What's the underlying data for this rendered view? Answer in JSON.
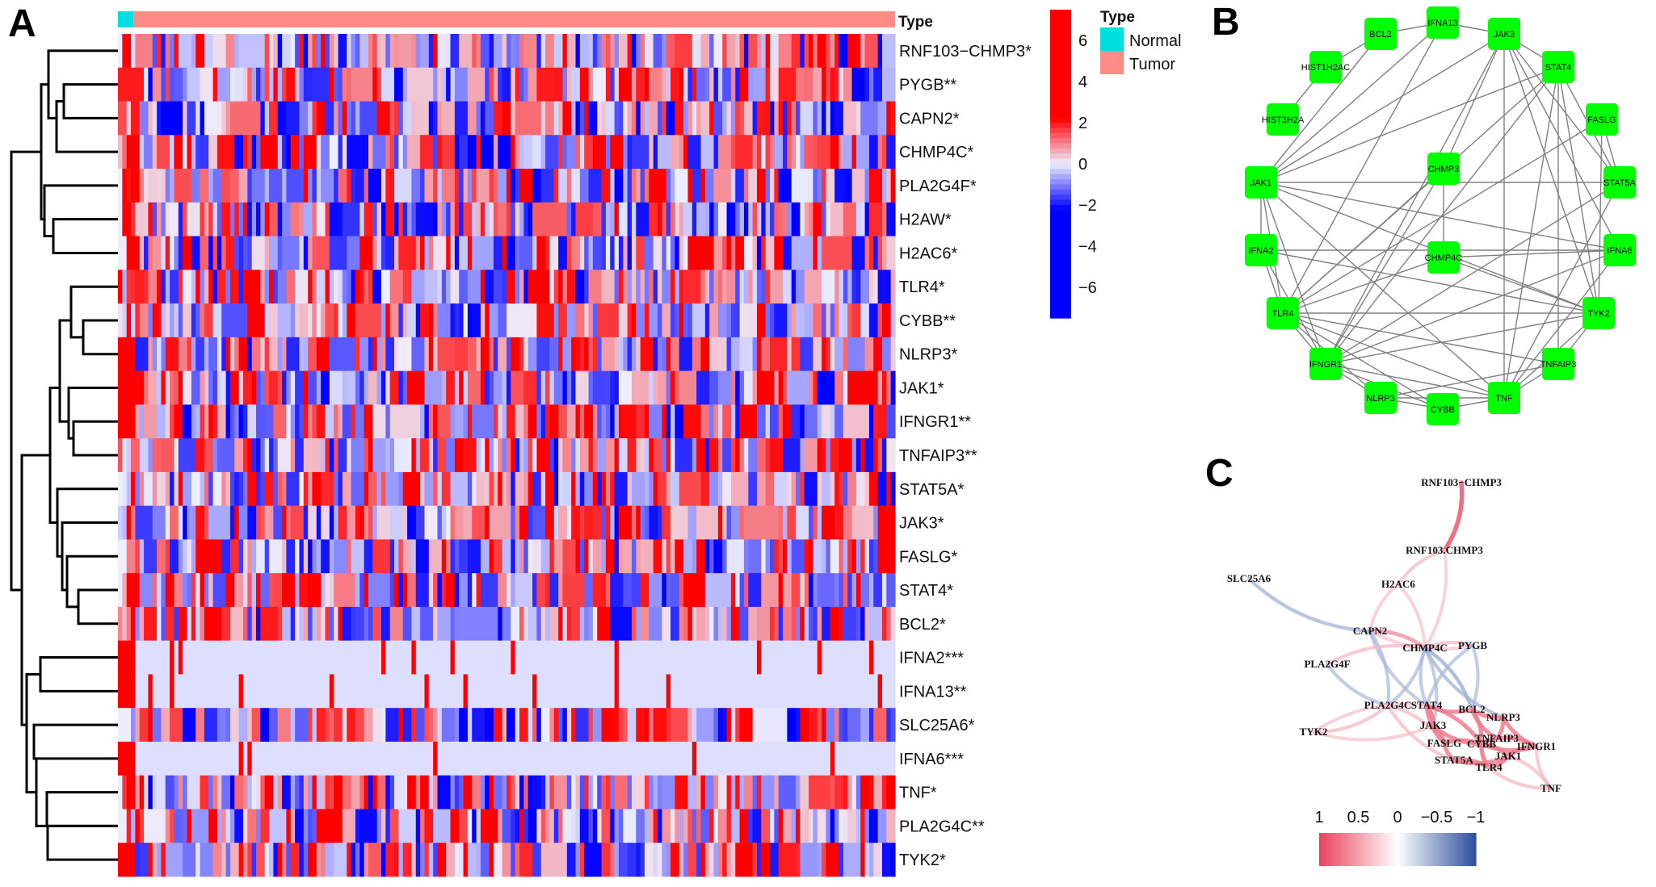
{
  "figure": {
    "panels": [
      "A",
      "B",
      "C"
    ]
  },
  "chart_data": [
    {
      "panel": "A",
      "type": "heatmap",
      "title": "",
      "annotation_title": "Type",
      "annotation_groups": [
        {
          "name": "Normal",
          "color": "#00DDDD",
          "fraction": 0.02
        },
        {
          "name": "Tumor",
          "color": "#FF8C84",
          "fraction": 0.98
        }
      ],
      "legend": {
        "title": "Type",
        "items": [
          {
            "label": "Normal",
            "color": "#00DDDD"
          },
          {
            "label": "Tumor",
            "color": "#FF8C84"
          }
        ]
      },
      "colorbar": {
        "ticks": [
          "6",
          "4",
          "2",
          "0",
          "−2",
          "−4",
          "−6"
        ],
        "tick_values": [
          6,
          4,
          2,
          0,
          -2,
          -4,
          -6
        ],
        "range": [
          -7.5,
          7.5
        ],
        "low_color": "#0000FF",
        "mid_color": "#EEEEFF",
        "high_color": "#FF0000"
      },
      "rows": [
        "RNF103−CHMP3*",
        "PYGB**",
        "CAPN2*",
        "CHMP4C*",
        "PLA2G4F*",
        "H2AW*",
        "H2AC6*",
        "TLR4*",
        "CYBB**",
        "NLRP3*",
        "JAK1*",
        "IFNGR1**",
        "TNFAIP3**",
        "STAT5A*",
        "JAK3*",
        "FASLG*",
        "STAT4*",
        "BCL2*",
        "IFNA2***",
        "IFNA13**",
        "SLC25A6*",
        "IFNA6***",
        "TNF*",
        "PLA2G4C**",
        "TYK2*"
      ],
      "row_pattern": [
        "mixed",
        "mixed",
        "mixed",
        "mixed",
        "mixed",
        "mixed",
        "mixed",
        "mixed",
        "mixed",
        "mixed",
        "mixed",
        "mixed",
        "mixed",
        "mixed",
        "mixed",
        "mixed",
        "mixed",
        "mixed",
        "sparse",
        "sparse",
        "mixed",
        "sparse",
        "mixed",
        "mixed",
        "mixed"
      ],
      "n_columns": 180,
      "dendrogram": "row clustering, left side"
    },
    {
      "panel": "B",
      "type": "network",
      "node_color": "#00FF00",
      "edge_color": "#808080",
      "nodes": [
        "IFNA13",
        "JAK3",
        "STAT4",
        "FASLG",
        "STAT5A",
        "IFNA6",
        "TYK2",
        "TNFAIP3",
        "TNF",
        "CYBB",
        "NLRP3",
        "IFNGR1",
        "TLR4",
        "IFNA2",
        "JAK1",
        "HIST3H2A",
        "HIST1H2AC",
        "BCL2",
        "CHMP3",
        "CHMP4C"
      ],
      "edges": [
        [
          "BCL2",
          "IFNA13"
        ],
        [
          "IFNA13",
          "JAK3"
        ],
        [
          "BCL2",
          "HIST1H2AC"
        ],
        [
          "HIST1H2AC",
          "HIST3H2A"
        ],
        [
          "BCL2",
          "JAK1"
        ],
        [
          "JAK3",
          "STAT4"
        ],
        [
          "JAK3",
          "JAK1"
        ],
        [
          "JAK3",
          "IFNGR1"
        ],
        [
          "JAK3",
          "CHMP3"
        ],
        [
          "JAK3",
          "TNF"
        ],
        [
          "JAK3",
          "STAT5A"
        ],
        [
          "JAK3",
          "IFNA6"
        ],
        [
          "JAK3",
          "TYK2"
        ],
        [
          "IFNA13",
          "JAK1"
        ],
        [
          "IFNA13",
          "TLR4"
        ],
        [
          "STAT4",
          "JAK1"
        ],
        [
          "STAT4",
          "STAT5A"
        ],
        [
          "STAT4",
          "TNFAIP3"
        ],
        [
          "STAT4",
          "TYK2"
        ],
        [
          "STAT4",
          "IFNGR1"
        ],
        [
          "STAT4",
          "TLR4"
        ],
        [
          "STAT4",
          "TNF"
        ],
        [
          "FASLG",
          "STAT5A"
        ],
        [
          "FASLG",
          "TYK2"
        ],
        [
          "FASLG",
          "TLR4"
        ],
        [
          "JAK1",
          "STAT5A"
        ],
        [
          "JAK1",
          "TYK2"
        ],
        [
          "JAK1",
          "IFNA6"
        ],
        [
          "JAK1",
          "IFNA2"
        ],
        [
          "JAK1",
          "TLR4"
        ],
        [
          "JAK1",
          "IFNGR1"
        ],
        [
          "JAK1",
          "TNF"
        ],
        [
          "CHMP3",
          "CHMP4C"
        ],
        [
          "CHMP3",
          "IFNGR1"
        ],
        [
          "CHMP3",
          "TLR4"
        ],
        [
          "IFNA2",
          "IFNA6"
        ],
        [
          "IFNA2",
          "TYK2"
        ],
        [
          "IFNA2",
          "TLR4"
        ],
        [
          "IFNA2",
          "IFNGR1"
        ],
        [
          "CHMP4C",
          "TLR4"
        ],
        [
          "CHMP4C",
          "TYK2"
        ],
        [
          "CHMP4C",
          "IFNA6"
        ],
        [
          "TLR4",
          "TYK2"
        ],
        [
          "TLR4",
          "TNF"
        ],
        [
          "TLR4",
          "TNFAIP3"
        ],
        [
          "TLR4",
          "IFNGR1"
        ],
        [
          "TLR4",
          "NLRP3"
        ],
        [
          "TLR4",
          "CYBB"
        ],
        [
          "TYK2",
          "IFNGR1"
        ],
        [
          "TYK2",
          "TNFAIP3"
        ],
        [
          "TYK2",
          "TNF"
        ],
        [
          "IFNA6",
          "TNF"
        ],
        [
          "IFNA6",
          "IFNGR1"
        ],
        [
          "STAT5A",
          "IFNGR1"
        ],
        [
          "STAT5A",
          "TNF"
        ],
        [
          "IFNGR1",
          "TNF"
        ],
        [
          "IFNGR1",
          "CYBB"
        ],
        [
          "IFNGR1",
          "NLRP3"
        ],
        [
          "NLRP3",
          "CYBB"
        ],
        [
          "NLRP3",
          "TNF"
        ],
        [
          "NLRP3",
          "TNFAIP3"
        ],
        [
          "CYBB",
          "TNF"
        ],
        [
          "TNF",
          "TNFAIP3"
        ]
      ]
    },
    {
      "panel": "C",
      "type": "network",
      "title": "",
      "colorbar": {
        "ticks": [
          "1",
          "0.5",
          "0",
          "−0.5",
          "−1"
        ],
        "tick_values": [
          1,
          0.5,
          0,
          -0.5,
          -1
        ],
        "positive_color": "#E8435E",
        "zero_color": "#FFFFFF",
        "negative_color": "#2E4F9E"
      },
      "nodes": [
        "RNF103−CHMP3",
        "RNF103.CHMP3",
        "SLC25A6",
        "H2AC6",
        "CAPN2",
        "CHMP4C",
        "PYGB",
        "PLA2G4F",
        "PLA2G4C",
        "STAT4",
        "BCL2",
        "NLRP3",
        "TYK2",
        "JAK3",
        "TNFAIP3",
        "FASLG",
        "CYBB",
        "IFNGR1",
        "JAK1",
        "STAT5A",
        "TLR4",
        "TNF"
      ],
      "edges": [
        {
          "source": "RNF103−CHMP3",
          "target": "RNF103.CHMP3",
          "r": 0.85
        },
        {
          "source": "RNF103.CHMP3",
          "target": "H2AC6",
          "r": 0.4
        },
        {
          "source": "RNF103.CHMP3",
          "target": "CHMP4C",
          "r": 0.35
        },
        {
          "source": "H2AC6",
          "target": "CAPN2",
          "r": 0.35
        },
        {
          "source": "H2AC6",
          "target": "CHMP4C",
          "r": 0.35
        },
        {
          "source": "SLC25A6",
          "target": "CAPN2",
          "r": -0.45
        },
        {
          "source": "CAPN2",
          "target": "CHMP4C",
          "r": 0.6
        },
        {
          "source": "CAPN2",
          "target": "PYGB",
          "r": 0.35
        },
        {
          "source": "CAPN2",
          "target": "PLA2G4C",
          "r": -0.4
        },
        {
          "source": "CAPN2",
          "target": "STAT4",
          "r": -0.4
        },
        {
          "source": "CHMP4C",
          "target": "PYGB",
          "r": 0.4
        },
        {
          "source": "CHMP4C",
          "target": "PLA2G4F",
          "r": 0.4
        },
        {
          "source": "CHMP4C",
          "target": "PLA2G4C",
          "r": -0.4
        },
        {
          "source": "CHMP4C",
          "target": "STAT4",
          "r": -0.4
        },
        {
          "source": "CHMP4C",
          "target": "BCL2",
          "r": -0.5
        },
        {
          "source": "CHMP4C",
          "target": "NLRP3",
          "r": -0.45
        },
        {
          "source": "CHMP4C",
          "target": "JAK3",
          "r": -0.4
        },
        {
          "source": "PYGB",
          "target": "STAT4",
          "r": -0.4
        },
        {
          "source": "PYGB",
          "target": "BCL2",
          "r": -0.4
        },
        {
          "source": "PLA2G4F",
          "target": "PLA2G4C",
          "r": -0.4
        },
        {
          "source": "PLA2G4C",
          "target": "TYK2",
          "r": 0.4
        },
        {
          "source": "PLA2G4C",
          "target": "STAT5A",
          "r": 0.4
        },
        {
          "source": "PLA2G4C",
          "target": "FASLG",
          "r": 0.4
        },
        {
          "source": "TYK2",
          "target": "JAK3",
          "r": 0.35
        },
        {
          "source": "TYK2",
          "target": "STAT4",
          "r": 0.35
        },
        {
          "source": "STAT4",
          "target": "BCL2",
          "r": 0.7
        },
        {
          "source": "STAT4",
          "target": "JAK3",
          "r": 0.75
        },
        {
          "source": "STAT4",
          "target": "FASLG",
          "r": 0.7
        },
        {
          "source": "STAT4",
          "target": "CYBB",
          "r": 0.7
        },
        {
          "source": "BCL2",
          "target": "NLRP3",
          "r": 0.7
        },
        {
          "source": "BCL2",
          "target": "CYBB",
          "r": 0.7
        },
        {
          "source": "BCL2",
          "target": "TNFAIP3",
          "r": 0.7
        },
        {
          "source": "NLRP3",
          "target": "TNFAIP3",
          "r": 0.7
        },
        {
          "source": "NLRP3",
          "target": "IFNGR1",
          "r": 0.7
        },
        {
          "source": "JAK3",
          "target": "FASLG",
          "r": 0.7
        },
        {
          "source": "JAK3",
          "target": "CYBB",
          "r": 0.7
        },
        {
          "source": "FASLG",
          "target": "CYBB",
          "r": 0.7
        },
        {
          "source": "FASLG",
          "target": "STAT5A",
          "r": 0.7
        },
        {
          "source": "CYBB",
          "target": "JAK1",
          "r": 0.75
        },
        {
          "source": "CYBB",
          "target": "TLR4",
          "r": 0.75
        },
        {
          "source": "CYBB",
          "target": "TNFAIP3",
          "r": 0.7
        },
        {
          "source": "CYBB",
          "target": "IFNGR1",
          "r": 0.7
        },
        {
          "source": "STAT5A",
          "target": "TLR4",
          "r": 0.7
        },
        {
          "source": "STAT5A",
          "target": "JAK1",
          "r": 0.7
        },
        {
          "source": "TNFAIP3",
          "target": "IFNGR1",
          "r": 0.7
        },
        {
          "source": "IFNGR1",
          "target": "JAK1",
          "r": 0.75
        },
        {
          "source": "JAK1",
          "target": "TLR4",
          "r": 0.75
        },
        {
          "source": "TLR4",
          "target": "TNF",
          "r": 0.4
        },
        {
          "source": "JAK1",
          "target": "TNF",
          "r": 0.4
        },
        {
          "source": "IFNGR1",
          "target": "TNF",
          "r": 0.4
        }
      ]
    }
  ]
}
